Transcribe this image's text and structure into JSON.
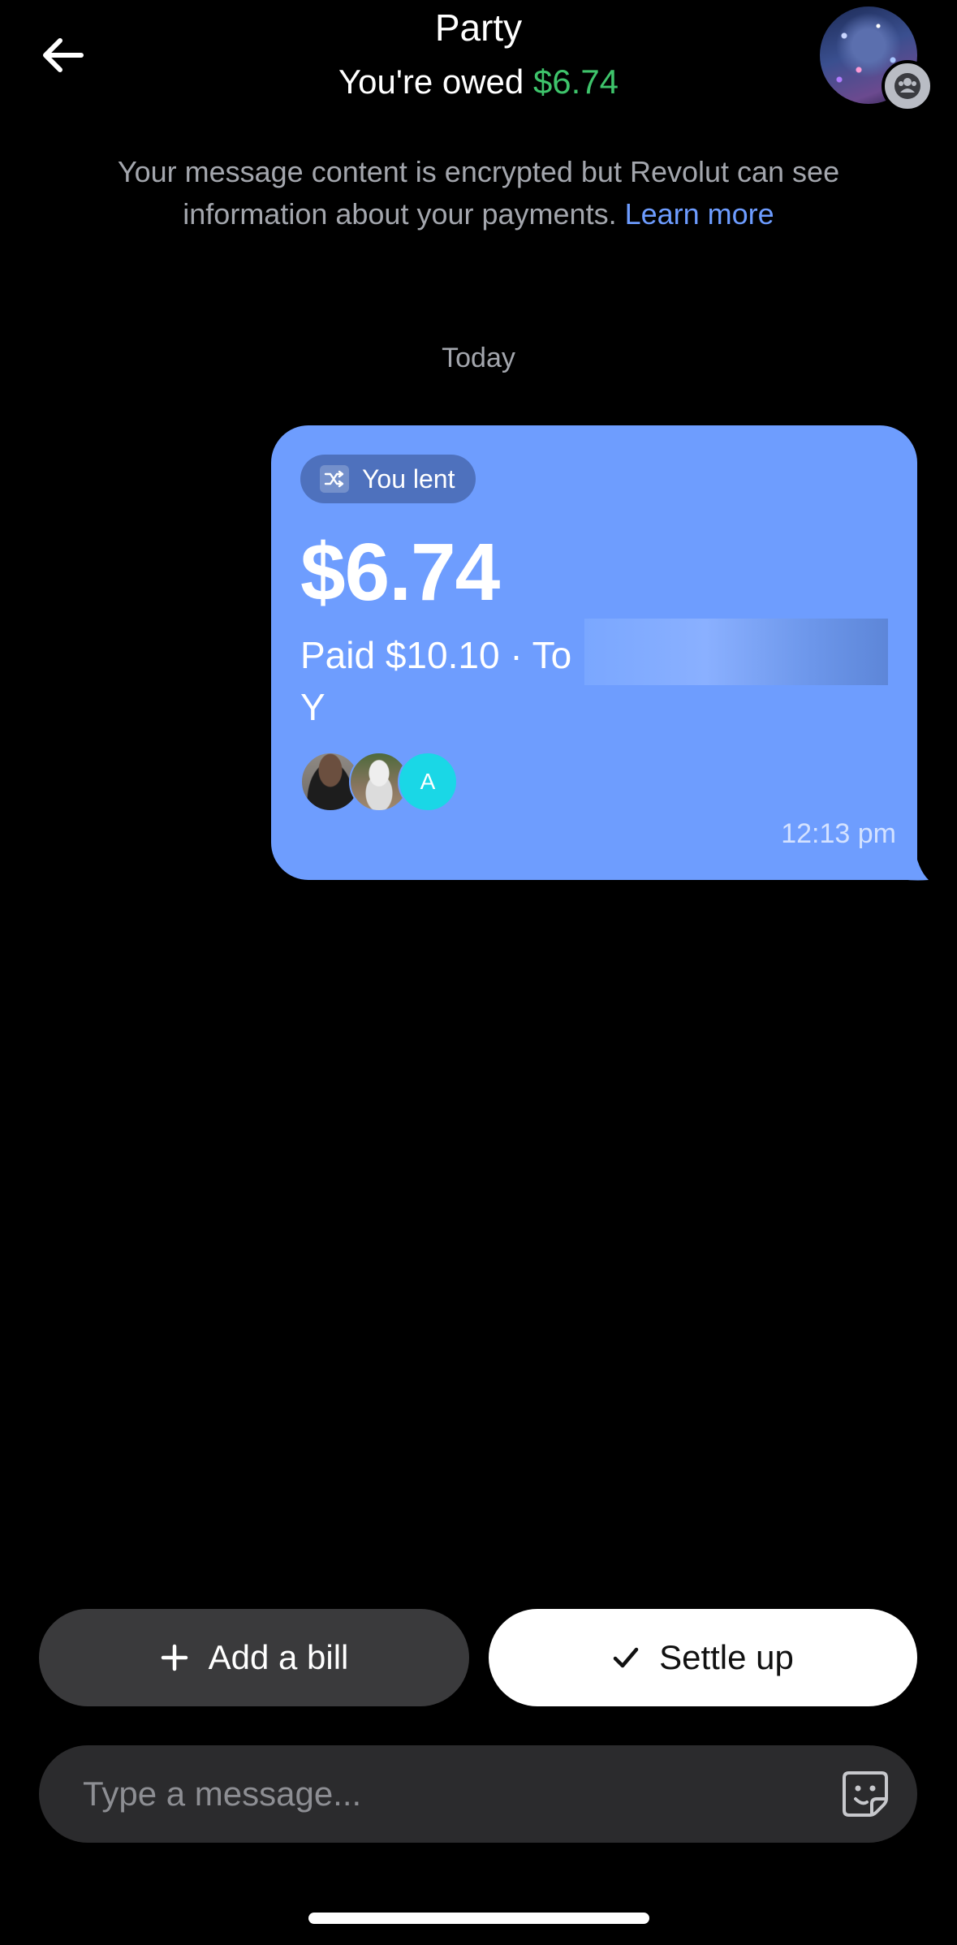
{
  "header": {
    "title": "Party",
    "owed_prefix": "You're owed",
    "owed_amount": "$6.74",
    "owed_color": "#3ec46b"
  },
  "icons": {
    "back": "arrow-left-icon",
    "group_badge": "people-icon",
    "lent": "shuffle-icon",
    "add": "plus-icon",
    "settle": "checkmark-icon",
    "sticker": "sticker-icon"
  },
  "notice": {
    "text": "Your message content is encrypted but Revolut can see information about your payments.",
    "link": "Learn more",
    "link_color": "#6d9cff"
  },
  "chat": {
    "day_label": "Today",
    "message": {
      "tag": "You lent",
      "amount": "$6.74",
      "paid_line": "Paid $10.10 · To",
      "paid_line_2": "Y",
      "participant_initial": "A",
      "time": "12:13 pm",
      "bubble_color": "#6e9dfe"
    }
  },
  "actions": {
    "add_bill": "Add a bill",
    "settle_up": "Settle up"
  },
  "composer": {
    "placeholder": "Type a message..."
  }
}
